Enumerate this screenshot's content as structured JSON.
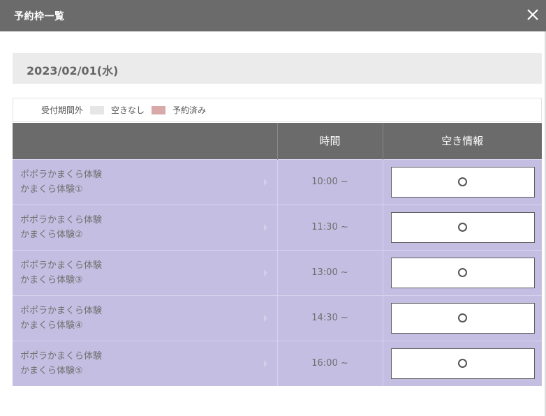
{
  "dialog": {
    "title": "予約枠一覧",
    "date": "2023/02/01(水)"
  },
  "legend": [
    {
      "label": "受付期間外",
      "color": "#e6e6e6"
    },
    {
      "label": "空きなし",
      "color": "#ffffff"
    },
    {
      "label": "予約済み",
      "color": "#d9a8a8"
    }
  ],
  "table": {
    "headers": [
      "",
      "時間",
      "空き情報"
    ],
    "rows": [
      {
        "plan": "ポポラかまくら体験",
        "sub": "かまくら体験①",
        "time": "10:00 ~",
        "status": "○"
      },
      {
        "plan": "ポポラかまくら体験",
        "sub": "かまくら体験②",
        "time": "11:30 ~",
        "status": "○"
      },
      {
        "plan": "ポポラかまくら体験",
        "sub": "かまくら体験③",
        "time": "13:00 ~",
        "status": "○"
      },
      {
        "plan": "ポポラかまくら体験",
        "sub": "かまくら体験④",
        "time": "14:30 ~",
        "status": "○"
      },
      {
        "plan": "ポポラかまくら体験",
        "sub": "かまくら体験⑤",
        "time": "16:00 ~",
        "status": "○"
      }
    ]
  }
}
